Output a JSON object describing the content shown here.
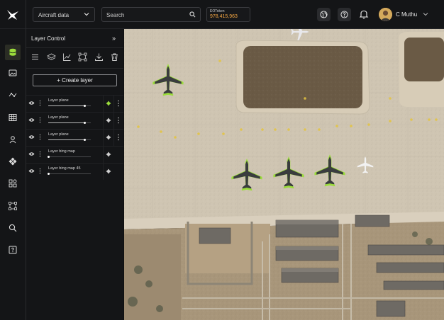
{
  "header": {
    "dataset_select": {
      "value": "Aircraft data",
      "icon": "chevron-down-icon"
    },
    "search": {
      "placeholder": "Search",
      "icon": "search-icon"
    },
    "token": {
      "label": "EOToken",
      "value": "978,415,963"
    },
    "actions": [
      {
        "name": "globe-icon"
      },
      {
        "name": "help-icon"
      },
      {
        "name": "bell-icon"
      }
    ],
    "user": {
      "name": "C Muthu"
    }
  },
  "rail": {
    "items": [
      {
        "icon": "layers-database-icon",
        "active": true
      },
      {
        "icon": "image-icon"
      },
      {
        "icon": "route-icon"
      },
      {
        "icon": "table-icon"
      },
      {
        "icon": "user-location-icon"
      },
      {
        "icon": "shapes-icon"
      },
      {
        "icon": "apps-grid-icon"
      },
      {
        "icon": "polygon-nodes-icon"
      },
      {
        "icon": "search-icon"
      },
      {
        "icon": "help-square-icon"
      }
    ]
  },
  "panel": {
    "title": "Layer Control",
    "collapse_label": "»",
    "toolbar": [
      {
        "icon": "menu-icon"
      },
      {
        "icon": "layers-icon"
      },
      {
        "icon": "chart-line-icon"
      },
      {
        "icon": "polygon-select-icon"
      },
      {
        "icon": "download-icon"
      },
      {
        "icon": "trash-icon"
      }
    ],
    "create_label": "+ Create layer",
    "layers": [
      {
        "name": "Layer plane",
        "opacity": 0.85,
        "has_menu": true,
        "style_active": true
      },
      {
        "name": "Layer plane",
        "opacity": 0.85,
        "has_menu": true,
        "style_active": false
      },
      {
        "name": "Layer plane",
        "opacity": 0.85,
        "has_menu": true,
        "style_active": false
      },
      {
        "name": "Layer bing map",
        "opacity": 0.0,
        "has_menu": false,
        "style_active": false
      },
      {
        "name": "Layer bing map 45",
        "opacity": 0.0,
        "has_menu": false,
        "style_active": false
      }
    ]
  },
  "map": {
    "highlight_color": "#9bdc3c",
    "detections": 4
  }
}
